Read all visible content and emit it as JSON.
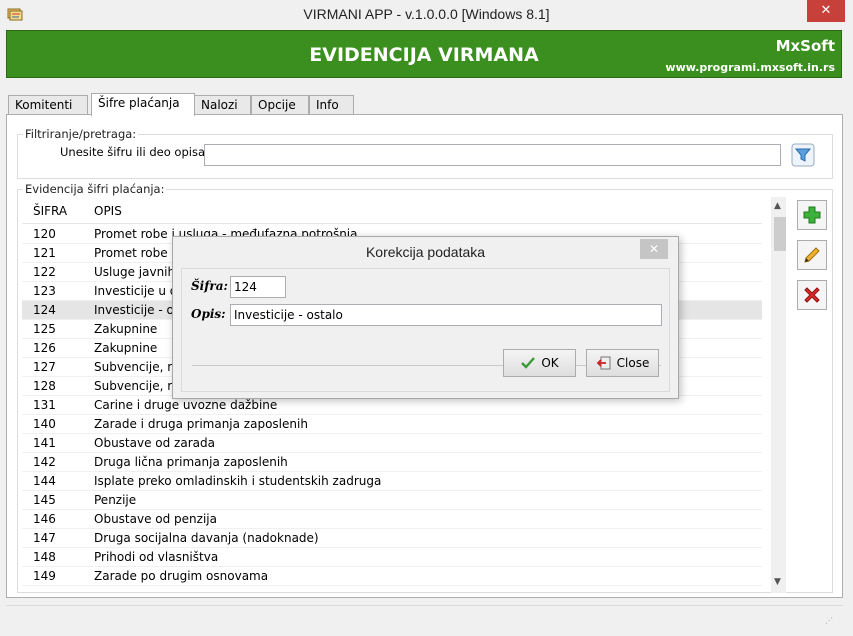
{
  "window": {
    "title": "VIRMANI APP - v.1.0.0.0  [Windows 8.1]",
    "close_glyph": "✕"
  },
  "banner": {
    "title": "EVIDENCIJA VIRMANA",
    "brand": "MxSoft",
    "url": "www.programi.mxsoft.in.rs",
    "color": "#3a8f1e"
  },
  "tabs": [
    {
      "label": "Komitenti",
      "active": false
    },
    {
      "label": "Šifre plaćanja",
      "active": true
    },
    {
      "label": "Nalozi",
      "active": false
    },
    {
      "label": "Opcije",
      "active": false
    },
    {
      "label": "Info",
      "active": false
    }
  ],
  "filter": {
    "group_label": "Filtriranje/pretraga:",
    "label": "Unesite šifru ili deo opisa:",
    "value": "",
    "button_icon": "filter-icon"
  },
  "records": {
    "group_label": "Evidencija šifri plaćanja:",
    "columns": [
      "ŠIFRA",
      "OPIS"
    ],
    "rows": [
      {
        "code": "120",
        "desc": "Promet robe i usluga - međufazna potrošnja"
      },
      {
        "code": "121",
        "desc": "Promet robe i u"
      },
      {
        "code": "122",
        "desc": "Usluge javnih p"
      },
      {
        "code": "123",
        "desc": "Investicije u ob"
      },
      {
        "code": "124",
        "desc": "Investicije - ost",
        "selected": true
      },
      {
        "code": "125",
        "desc": "Zakupnine"
      },
      {
        "code": "126",
        "desc": "Zakupnine"
      },
      {
        "code": "127",
        "desc": "Subvencije, reg"
      },
      {
        "code": "128",
        "desc": "Subvencije, reg"
      },
      {
        "code": "131",
        "desc": "Carine i druge uvozne dažbine"
      },
      {
        "code": "140",
        "desc": "Zarade i druga primanja zaposlenih"
      },
      {
        "code": "141",
        "desc": "Obustave od zarada"
      },
      {
        "code": "142",
        "desc": "Druga lična primanja zaposlenih"
      },
      {
        "code": "144",
        "desc": "Isplate preko omladinskih i studentskih zadruga"
      },
      {
        "code": "145",
        "desc": "Penzije"
      },
      {
        "code": "146",
        "desc": "Obustave od penzija"
      },
      {
        "code": "147",
        "desc": "Druga socijalna davanja (nadoknade)"
      },
      {
        "code": "148",
        "desc": "Prihodi od vlasništva"
      },
      {
        "code": "149",
        "desc": "Zarade po drugim osnovama"
      }
    ],
    "actions": [
      {
        "name": "add-icon",
        "color": "#2aa12a"
      },
      {
        "name": "edit-icon",
        "color": "#e0a020"
      },
      {
        "name": "delete-icon",
        "color": "#d42020"
      }
    ]
  },
  "dialog": {
    "title": "Korekcija podataka",
    "close_glyph": "✕",
    "code_label": "Šifra:",
    "code_value": "124",
    "desc_label": "Opis:",
    "desc_value": "Investicije - ostalo",
    "ok_label": "OK",
    "close_label": "Close"
  }
}
